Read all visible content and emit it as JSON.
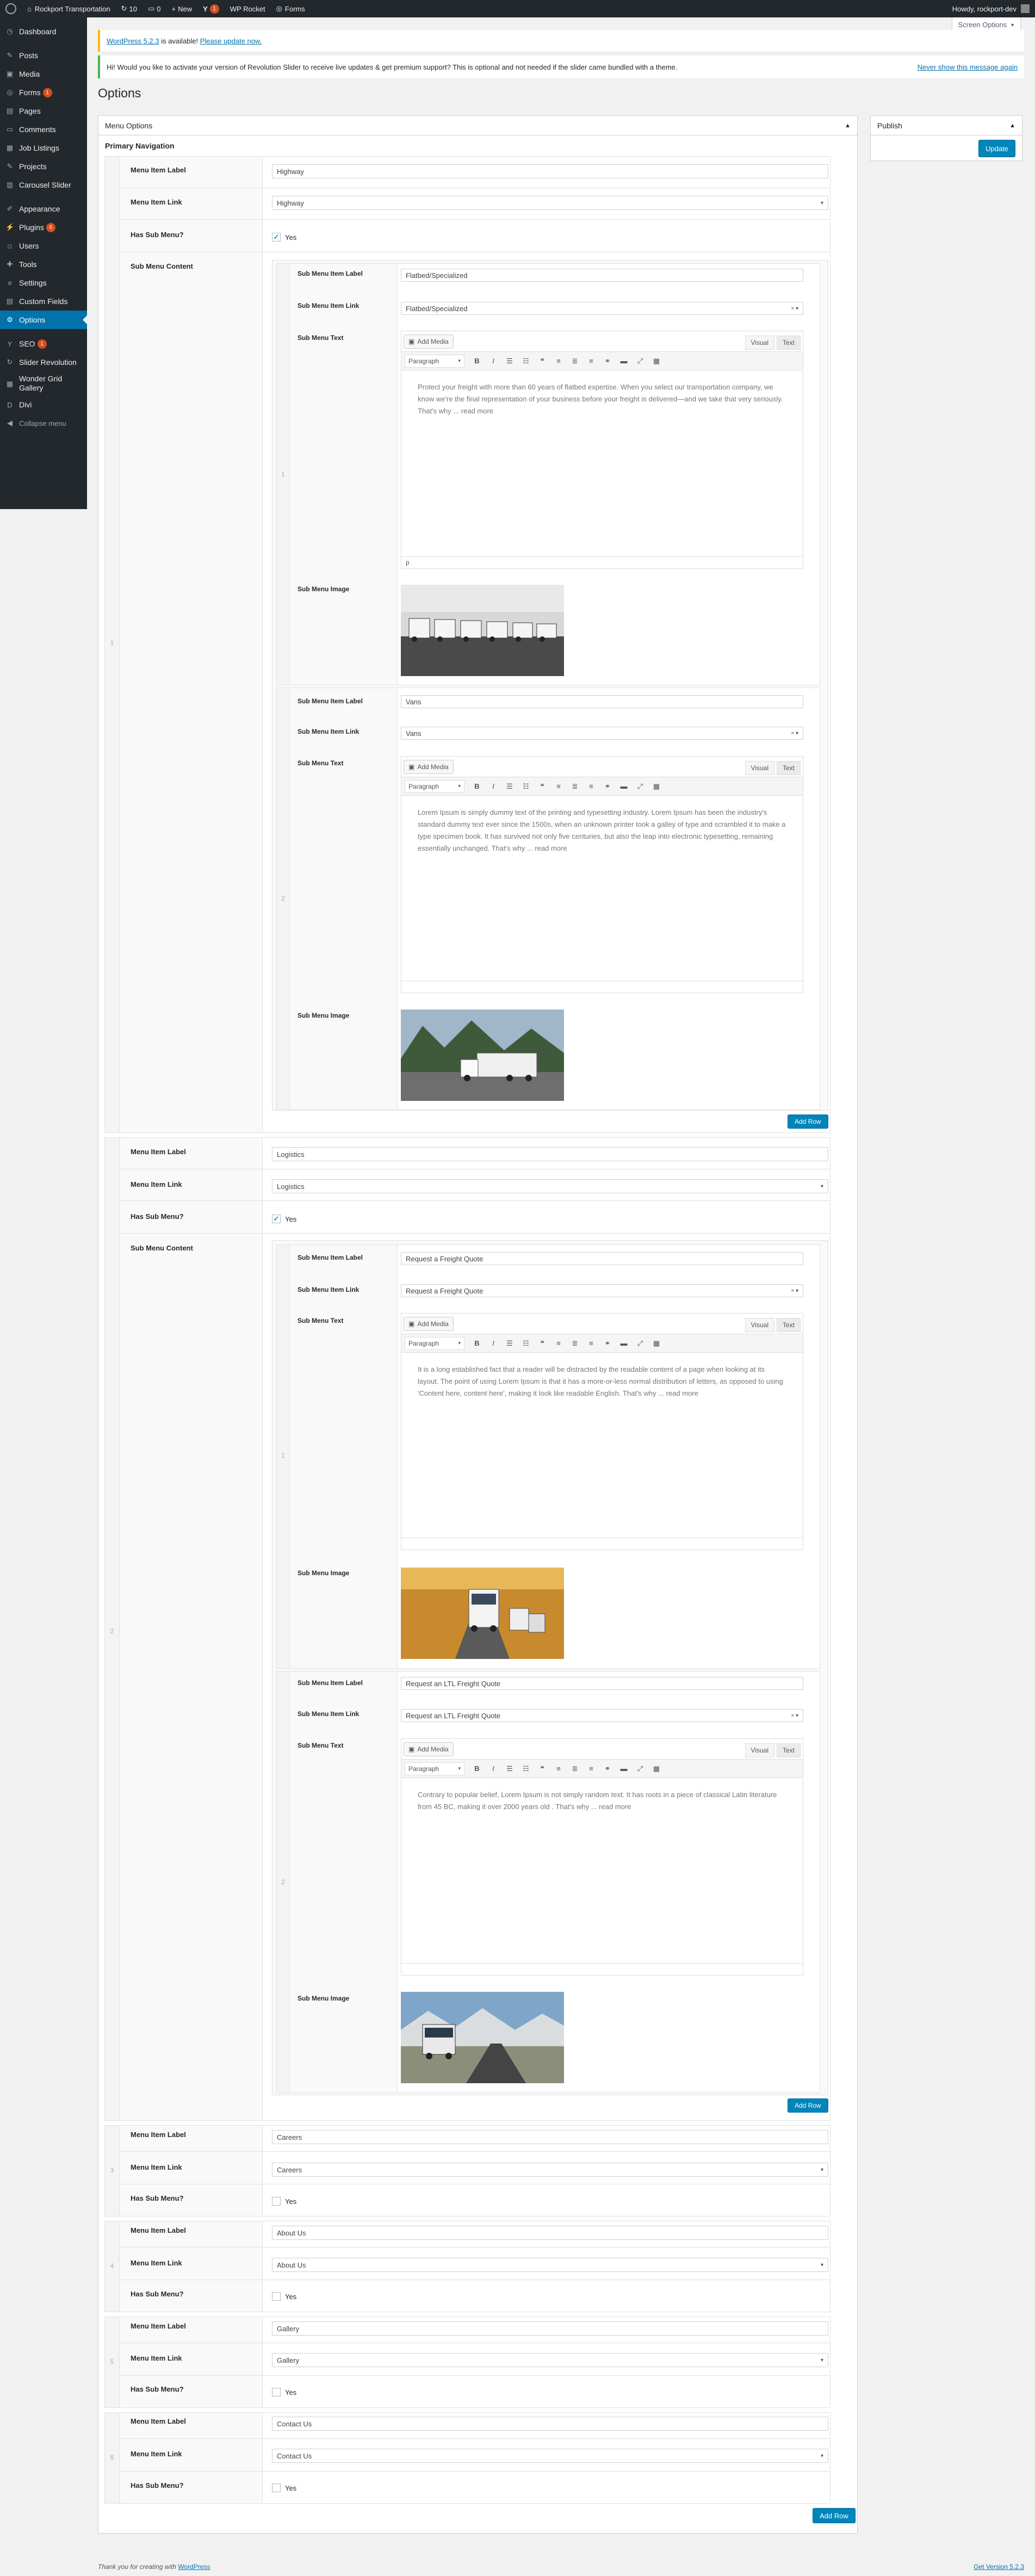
{
  "admin_bar": {
    "site_name": "Rockport Transportation",
    "updates_count": "10",
    "comments_count": "0",
    "new_label": "New",
    "yoast_count": "1",
    "wp_rocket": "WP Rocket",
    "forms": "Forms",
    "howdy": "Howdy, rockport-dev"
  },
  "screen_options": "Screen Options",
  "sidebar": {
    "items": [
      {
        "label": "Dashboard",
        "icon": "dashboard-icon"
      },
      {
        "label": "Posts",
        "icon": "pin-icon"
      },
      {
        "label": "Media",
        "icon": "media-icon"
      },
      {
        "label": "Forms",
        "icon": "forms-icon",
        "badge": "1"
      },
      {
        "label": "Pages",
        "icon": "pages-icon"
      },
      {
        "label": "Comments",
        "icon": "comments-icon"
      },
      {
        "label": "Job Listings",
        "icon": "briefcase-icon"
      },
      {
        "label": "Projects",
        "icon": "pin-icon"
      },
      {
        "label": "Carousel Slider",
        "icon": "slides-icon"
      },
      {
        "label": "Appearance",
        "icon": "brush-icon"
      },
      {
        "label": "Plugins",
        "icon": "plugin-icon",
        "badge": "6"
      },
      {
        "label": "Users",
        "icon": "users-icon"
      },
      {
        "label": "Tools",
        "icon": "wrench-icon"
      },
      {
        "label": "Settings",
        "icon": "settings-icon"
      },
      {
        "label": "Custom Fields",
        "icon": "fields-icon"
      },
      {
        "label": "Options",
        "icon": "gear-icon"
      },
      {
        "label": "SEO",
        "icon": "yoast-icon",
        "badge": "1"
      },
      {
        "label": "Slider Revolution",
        "icon": "revolution-icon"
      },
      {
        "label": "Wonder Grid Gallery",
        "icon": "grid-icon"
      },
      {
        "label": "Divi",
        "icon": "divi-icon"
      },
      {
        "label": "Collapse menu",
        "icon": "collapse-icon"
      }
    ]
  },
  "notices": {
    "update_link": "WordPress 5.2.3",
    "update_text": " is available! ",
    "update_now": "Please update now.",
    "revslider_text": "Hi! Would you like to activate your version of Revolution Slider to receive live updates & get premium support? This is optional and not needed if the slider came bundled with a theme.",
    "revslider_dismiss": "Never show this message again"
  },
  "page_title": "Options",
  "postbox": {
    "title": "Menu Options",
    "section": "Primary Navigation"
  },
  "publish": {
    "title": "Publish",
    "button": "Update"
  },
  "labels": {
    "item_label": "Menu Item Label",
    "item_link": "Menu Item Link",
    "has_sub": "Has Sub Menu?",
    "sub_content": "Sub Menu Content",
    "sub_label": "Sub Menu Item Label",
    "sub_link": "Sub Menu Item Link",
    "sub_text": "Sub Menu Text",
    "sub_image": "Sub Menu Image",
    "yes": "Yes",
    "add_row": "Add Row",
    "add_media": "Add Media",
    "visual": "Visual",
    "text": "Text",
    "paragraph": "Paragraph",
    "p_tag": "p"
  },
  "menu_items": [
    {
      "label": "Highway",
      "link": "Highway",
      "subs": [
        {
          "label": "Flatbed/Specialized",
          "link": "Flatbed/Specialized",
          "text": "Protect your freight with more than 60 years of flatbed expertise. When you select our transportation company, we know we're the final representation of your business before your freight is delivered—and we take that very seriously. That's why ... read more"
        },
        {
          "label": "Vans",
          "link": "Vans",
          "text": "Lorem Ipsum is simply dummy text of the printing and typesetting industry. Lorem Ipsum has been the industry's standard dummy text ever since the 1500s, when an unknown printer took a galley of type and scrambled it to make a type specimen book. It has survived not only five centuries, but also the leap into electronic typesetting, remaining essentially unchanged. That's why ... read more"
        }
      ]
    },
    {
      "label": "Logistics",
      "link": "Logistics",
      "subs": [
        {
          "label": "Request a Freight Quote",
          "link": "Request a Freight Quote",
          "text": "It is a long established fact that a reader will be distracted by the readable content of a page when looking at its layout. The point of using Lorem Ipsum is that it has a more-or-less normal distribution of letters, as opposed to using 'Content here, content here', making it look like readable English. That's why ... read more"
        },
        {
          "label": "Request an  LTL Freight Quote",
          "link": "Request an LTL Freight Quote",
          "text": "Contrary to popular belief, Lorem Ipsum is not simply random text. It has roots in a piece of classical Latin literature from 45 BC, making it over 2000 years old . That's why ... read more"
        }
      ]
    },
    {
      "label": "Careers",
      "link": "Careers",
      "order": "3"
    },
    {
      "label": "About Us",
      "link": "About Us",
      "order": "4"
    },
    {
      "label": "Gallery",
      "link": "Gallery",
      "order": "5"
    },
    {
      "label": "Contact Us",
      "link": "Contact Us",
      "order": "6"
    }
  ],
  "order_numbers": {
    "m1": "1",
    "m2": "2",
    "s1": "1",
    "s2": "2"
  },
  "footer": {
    "thanks": "Thank you for creating with ",
    "wordpress": "WordPress",
    "version_link": "Get Version 5.2.3"
  },
  "colors": {
    "accent": "#0073aa",
    "button": "#0085ba",
    "adminbar": "#23282d",
    "badge": "#d54e21"
  }
}
